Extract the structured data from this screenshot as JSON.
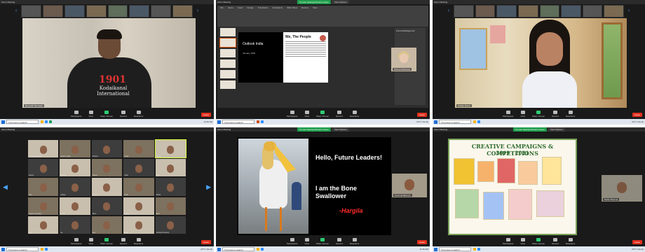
{
  "panels": {
    "p1": {
      "window_title": "Zoom Meeting",
      "speaker_name": "Ramnath Ramaiah",
      "hoodie_number": "1901",
      "hoodie_line": "Kodaikanal International"
    },
    "p2": {
      "window_title": "Zoom Meeting",
      "share_notice": "You are viewing Karma's screen",
      "view_options": "View Options",
      "ppt_tabs": [
        "File",
        "Home",
        "Insert",
        "Design",
        "Transitions",
        "Animations",
        "Slide Show",
        "Review",
        "View"
      ],
      "slide_left_title": "Outlook India",
      "slide_left_bullet": "January 1903",
      "slide_right_title": "We, The People",
      "props_title": "Format Background",
      "presenter_name": "Shriya Mukherjee"
    },
    "p3": {
      "window_title": "Zoom Meeting",
      "speaker_name": "Shailja Raina"
    },
    "p4": {
      "window_title": "Zoom Meeting",
      "tiles": [
        "Ananya Prakash",
        "Sarah Gupta",
        "Pranav",
        "Anika",
        "Ishaan",
        "Kavya",
        "Rohan",
        "Meera",
        "Arjun",
        "Diya",
        "Tara",
        "Aditya",
        "Sneha",
        "Kabir",
        "Nisha",
        "Sarah Choudhry",
        "Vivek",
        "Riya",
        "Aarav",
        "Zara",
        "Neil",
        "Ira",
        "Dev",
        "Mira",
        "Akshay Khurana"
      ]
    },
    "p5": {
      "window_title": "Zoom Meeting",
      "share_notice": "You are viewing Karma's screen",
      "view_options": "View Options",
      "slide_line1": "Hello, Future Leaders!",
      "slide_line2": "I am the Bone Swallower",
      "slide_signature": "-Hargila",
      "cam_name": "Purnima Barman"
    },
    "p6": {
      "window_title": "Zoom Meeting",
      "share_notice": "You are viewing Karma's screen",
      "view_options": "View Options",
      "slide_title": "CREATIVE CAMPAIGNS & COMPETITIONS",
      "slide_years": "2019 - 2021",
      "cam_name": "Rahul Sharma"
    }
  },
  "toolbar": {
    "mute": "Mute",
    "start_video": "Start Video",
    "participants": "Participants",
    "chat": "Chat",
    "share_screen": "Share Screen",
    "record": "Record",
    "reactions": "Reactions",
    "end": "Leave"
  },
  "taskbar": {
    "search_placeholder": "Type here to search",
    "weather": "20°C Cloudy",
    "clock_left": "10:46 AM",
    "clock_right": "11:39 AM"
  },
  "colors": {
    "zoom_blue": "#4aa3ff",
    "end_red": "#e0301e",
    "share_green": "#1f9d4b"
  }
}
